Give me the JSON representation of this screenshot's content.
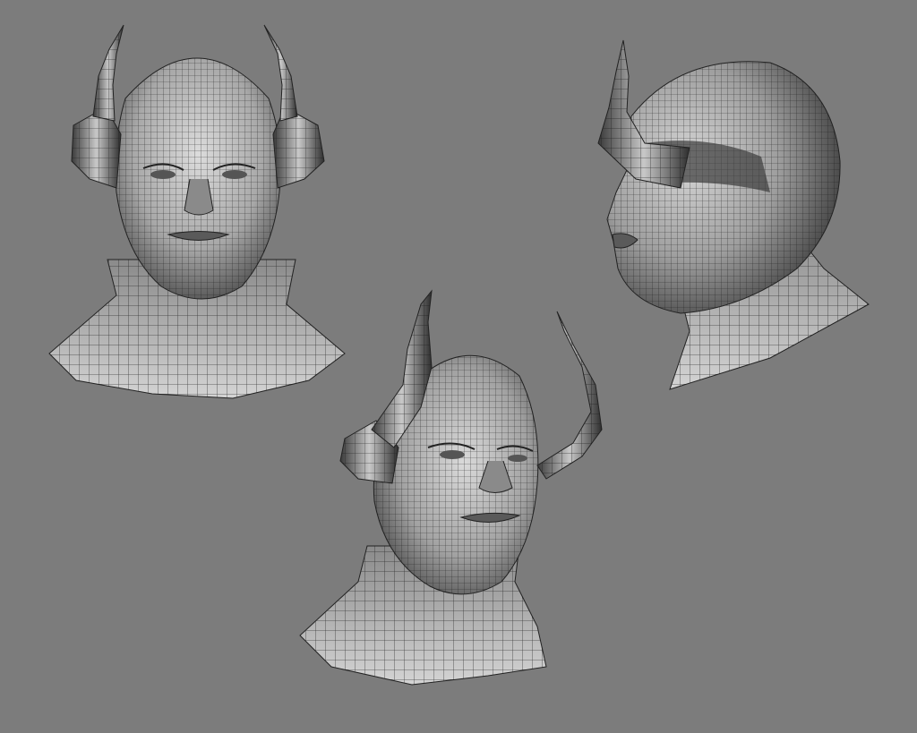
{
  "scene": {
    "background_color": "#7c7c7c",
    "model_shade_light": "#dcdcdc",
    "model_shade_mid": "#9a9a9a",
    "model_shade_dark": "#3c3c3c",
    "wire_color": "#1a1a1a",
    "views": [
      {
        "view": "front",
        "subject": "horned-demon-head-wireframe"
      },
      {
        "view": "side",
        "subject": "horned-demon-head-wireframe"
      },
      {
        "view": "three-quarter",
        "subject": "horned-demon-head-wireframe"
      }
    ]
  }
}
